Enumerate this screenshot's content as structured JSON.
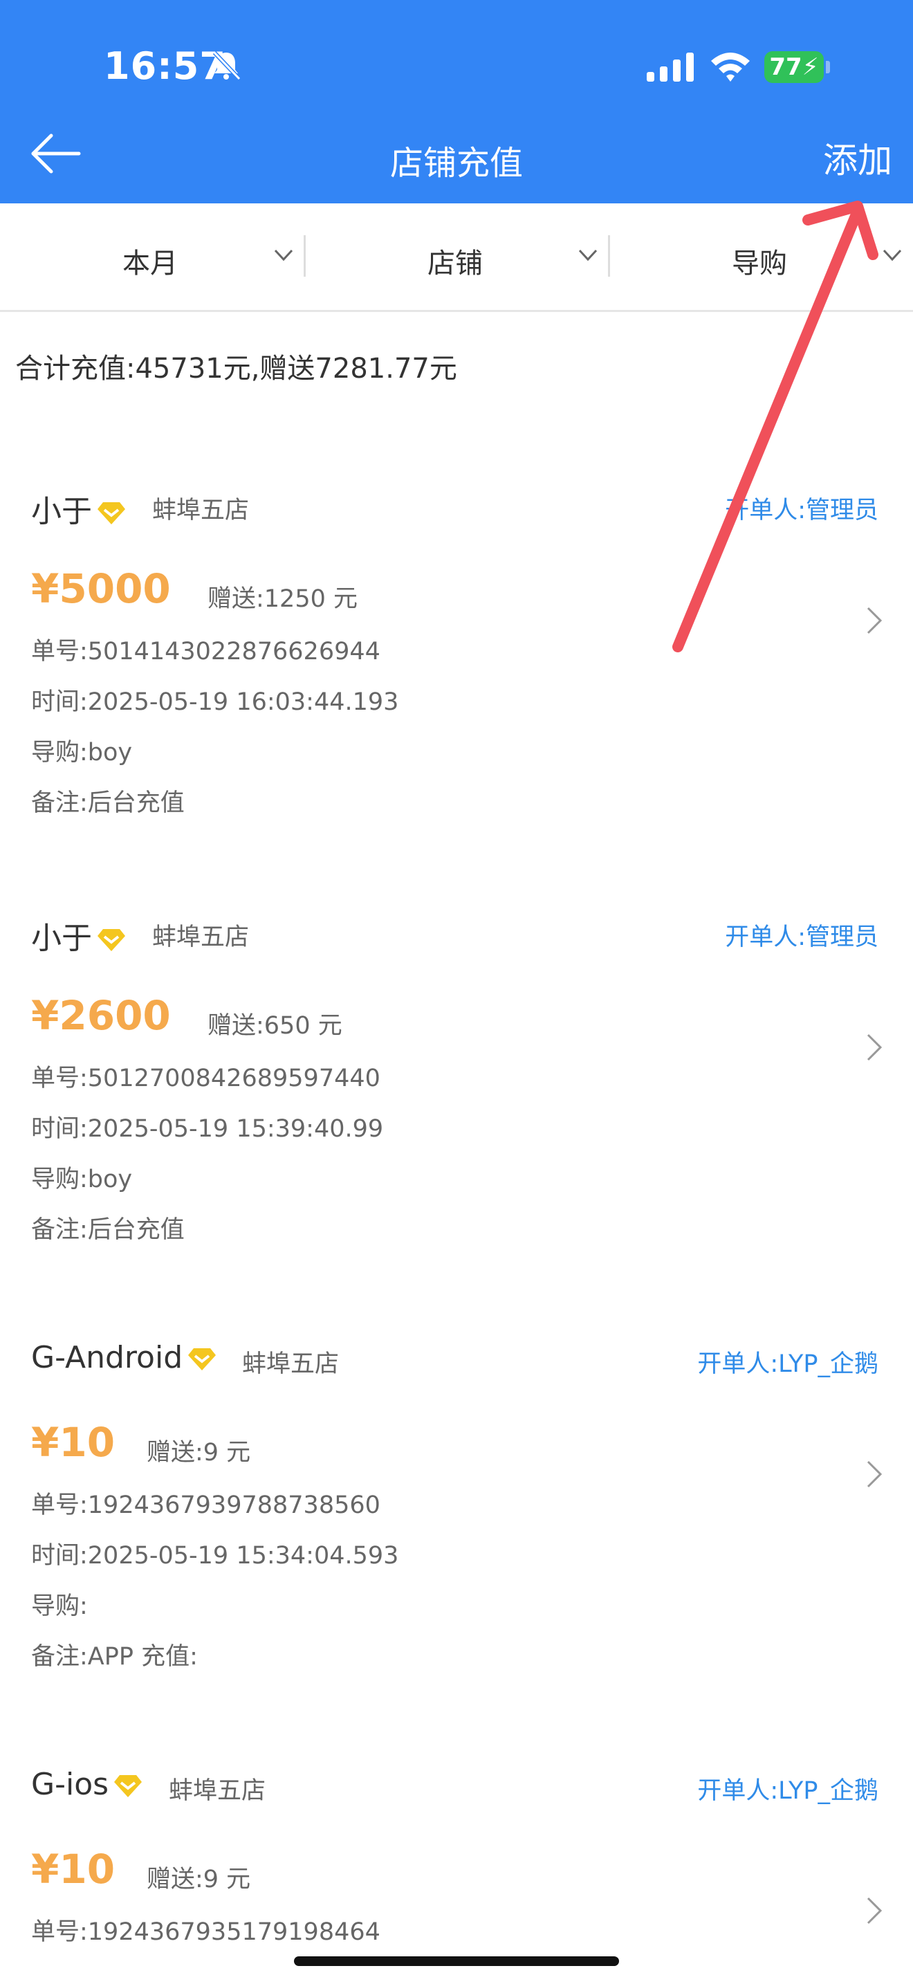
{
  "status_bar": {
    "time": "16:57",
    "battery": "77"
  },
  "header": {
    "title": "店铺充值",
    "add_label": "添加"
  },
  "filters": [
    {
      "label": "本月"
    },
    {
      "label": "店铺"
    },
    {
      "label": "导购"
    }
  ],
  "summary": "合计充值:45731元,赠送7281.77元",
  "records": [
    {
      "name": "小于",
      "store": "蚌埠五店",
      "operator": "开单人:管理员",
      "amount": "¥5000",
      "gift": "赠送:1250 元",
      "order_no": "单号:5014143022876626944",
      "time": "时间:2025-05-19 16:03:44.193",
      "guide": "导购:boy",
      "note": "备注:后台充值"
    },
    {
      "name": "小于",
      "store": "蚌埠五店",
      "operator": "开单人:管理员",
      "amount": "¥2600",
      "gift": "赠送:650 元",
      "order_no": "单号:5012700842689597440",
      "time": "时间:2025-05-19 15:39:40.99",
      "guide": "导购:boy",
      "note": "备注:后台充值"
    },
    {
      "name": "G-Android",
      "store": "蚌埠五店",
      "operator": "开单人:LYP_企鹅",
      "amount": "¥10",
      "gift": "赠送:9 元",
      "order_no": "单号:1924367939788738560",
      "time": "时间:2025-05-19 15:34:04.593",
      "guide": "导购:",
      "note": "备注:APP 充值:"
    },
    {
      "name": "G-ios",
      "store": "蚌埠五店",
      "operator": "开单人:LYP_企鹅",
      "amount": "¥10",
      "gift": "赠送:9 元",
      "order_no": "单号:1924367935179198464"
    }
  ],
  "colors": {
    "header": "#3385f5",
    "amount": "#f5a94c",
    "operator": "#2f8be8",
    "annotation_arrow": "#f0505a"
  }
}
